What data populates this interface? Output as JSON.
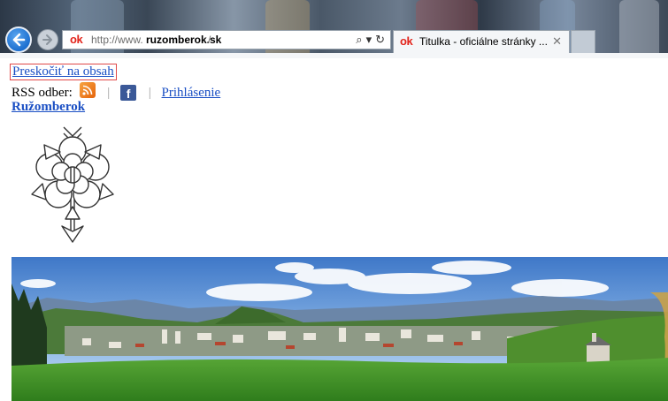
{
  "browser": {
    "url_prefix": "http://www.",
    "url_domain": "ruzomberok.sk",
    "url_rest": "/",
    "site_icon": "ok",
    "search_icon": "⌕",
    "dropdown_icon": "▾",
    "refresh_icon": "↻",
    "tab_title": "Titulka - oficiálne stránky ...",
    "tab_close": "✕"
  },
  "page": {
    "skip_link": "Preskočiť na obsah",
    "rss_label": "RSS odber:",
    "separator": "|",
    "facebook_glyph": "f",
    "login_link": "Prihlásenie",
    "city_link": "Ružomberok"
  },
  "colors": {
    "link": "#1a4fc4",
    "brand_red": "#e2231a",
    "rss_orange": "#f28a1e",
    "facebook_blue": "#3b5998"
  }
}
